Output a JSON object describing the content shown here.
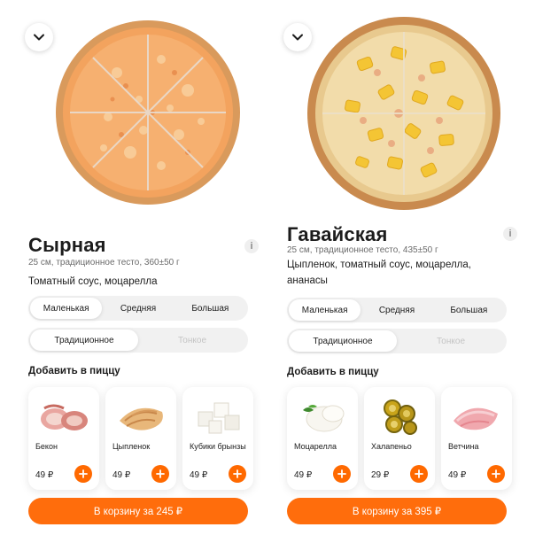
{
  "accent_color": "#ff6900",
  "cards": [
    {
      "title": "Сырная",
      "meta": "25 см, традиционное тесто, 360±50 г",
      "description": "Томатный соус, моцарелла",
      "info_label": "i",
      "sizes": [
        "Маленькая",
        "Средняя",
        "Большая"
      ],
      "selected_size": "Маленькая",
      "doughs": [
        "Традиционное",
        "Тонкое"
      ],
      "selected_dough": "Традиционное",
      "add_title": "Добавить в пиццу",
      "toppings": [
        {
          "name": "Бекон",
          "price": "49 ₽",
          "icon": "bacon-icon"
        },
        {
          "name": "Цыпленок",
          "price": "49 ₽",
          "icon": "chicken-icon"
        },
        {
          "name": "Кубики брынзы",
          "price": "49 ₽",
          "icon": "feta-cubes-icon"
        }
      ],
      "cart_label": "В корзину за 245 ₽"
    },
    {
      "title": "Гавайская",
      "meta": "25 см, традиционное тесто, 435±50 г",
      "description": "Цыпленок, томатный соус, моцарелла, ананасы",
      "info_label": "i",
      "sizes": [
        "Маленькая",
        "Средняя",
        "Большая"
      ],
      "selected_size": "Маленькая",
      "doughs": [
        "Традиционное",
        "Тонкое"
      ],
      "selected_dough": "Традиционное",
      "add_title": "Добавить в пиццу",
      "toppings": [
        {
          "name": "Моцарелла",
          "price": "49 ₽",
          "icon": "mozzarella-icon"
        },
        {
          "name": "Халапеньо",
          "price": "29 ₽",
          "icon": "jalapeno-icon"
        },
        {
          "name": "Ветчина",
          "price": "49 ₽",
          "icon": "ham-icon"
        }
      ],
      "cart_label": "В корзину за 395 ₽"
    }
  ]
}
